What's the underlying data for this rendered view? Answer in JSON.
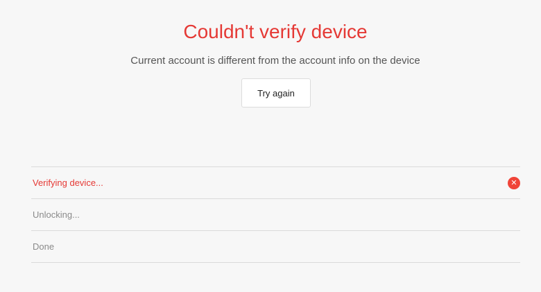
{
  "status": {
    "title": "Couldn't verify device",
    "message": "Current account is different from the account info on the device",
    "retry_label": "Try again"
  },
  "steps": [
    {
      "label": "Verifying device...",
      "state": "error",
      "icon": "error-x-icon"
    },
    {
      "label": "Unlocking...",
      "state": "pending"
    },
    {
      "label": "Done",
      "state": "pending"
    }
  ],
  "colors": {
    "error": "#e53935",
    "error_icon": "#f04438",
    "muted_text": "#8a8a8a",
    "background": "#f7f7f7"
  }
}
